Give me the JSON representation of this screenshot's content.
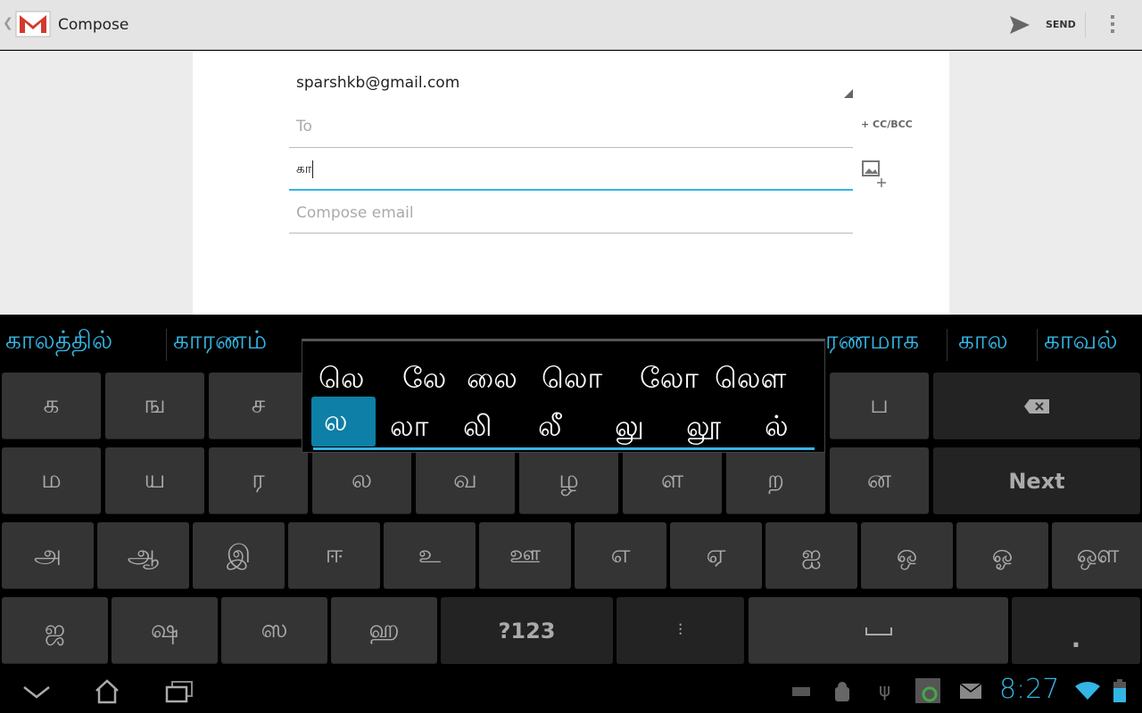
{
  "action_bar": {
    "title": "Compose",
    "send_label": "SEND",
    "back_icon": "chevron-left-icon",
    "app_icon": "gmail-icon",
    "overflow_icon": "overflow-icon"
  },
  "compose": {
    "from": "sparshkb@gmail.com",
    "to_placeholder": "To",
    "cc_bcc": "+ CC/BCC",
    "subject_value": "கா",
    "body_placeholder": "Compose email"
  },
  "suggestions": [
    "காலத்தில்",
    "காரணம்",
    "ரணமாக",
    "கால",
    "காவல்"
  ],
  "popup": {
    "row1": [
      "லெ",
      "லே",
      "லை",
      "லொ",
      "லோ",
      "லௌ"
    ],
    "row2": [
      "ல",
      "லா",
      "லி",
      "லீ",
      "லு",
      "லூ",
      "ல்"
    ],
    "selected": "ல",
    "accent": "#33b5e5"
  },
  "keyboard": {
    "row1": [
      "க",
      "ங",
      "ச",
      "",
      "",
      "",
      "",
      "",
      "ப"
    ],
    "row2": [
      "ம",
      "ய",
      "ர",
      "ல",
      "வ",
      "ழ",
      "ள",
      "ற",
      "ன"
    ],
    "next": "Next",
    "row3": [
      "அ",
      "ஆ",
      "இ",
      "ஈ",
      "உ",
      "ஊ",
      "எ",
      "ஏ",
      "ஐ",
      "ஒ",
      "ஓ",
      "ஔ"
    ],
    "row4": [
      "ஜ",
      "ஷ",
      "ஸ",
      "ஹ"
    ],
    "symbols": "?123",
    "period": "."
  },
  "status_bar": {
    "time": "8:27",
    "clock_color": "#33b5e5"
  }
}
